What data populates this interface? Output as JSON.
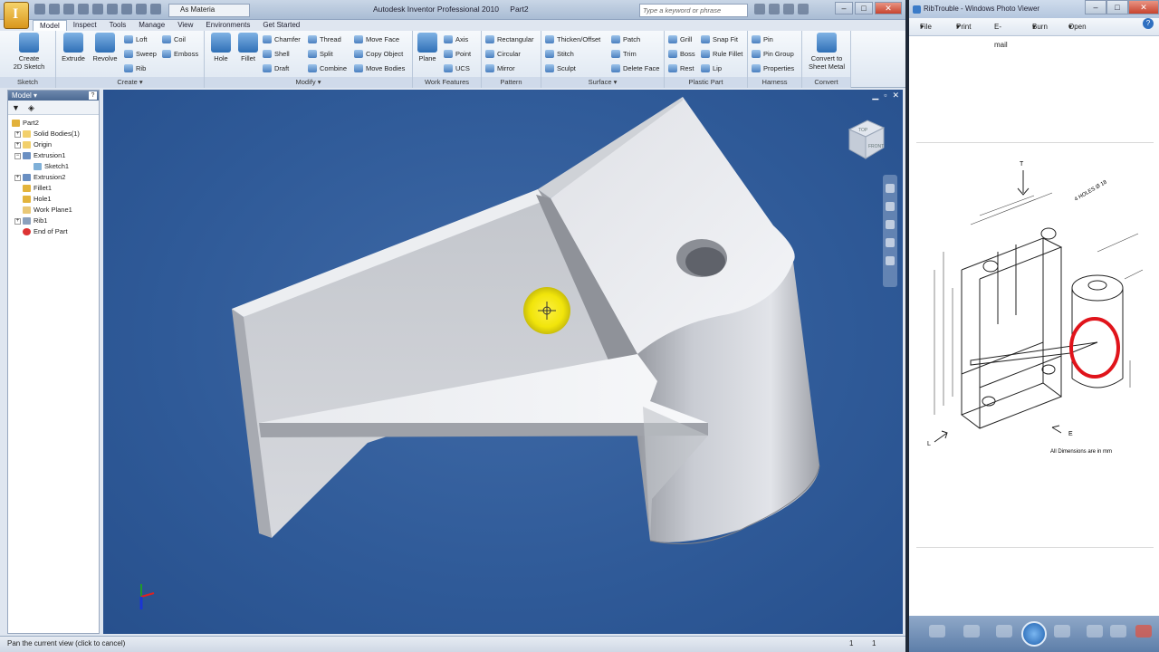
{
  "inventor": {
    "title_app": "Autodesk Inventor Professional 2010",
    "title_doc": "Part2",
    "material": "As Materia",
    "search_placeholder": "Type a keyword or phrase",
    "tabs": [
      "Model",
      "Inspect",
      "Tools",
      "Manage",
      "View",
      "Environments",
      "Get Started"
    ],
    "ribbon": {
      "sketch": {
        "create": "Create",
        "sketch2d": "2D Sketch",
        "label": "Sketch"
      },
      "create": {
        "extrude": "Extrude",
        "revolve": "Revolve",
        "loft": "Loft",
        "coil": "Coil",
        "sweep": "Sweep",
        "emboss": "Emboss",
        "rib": "Rib",
        "label": "Create"
      },
      "modify": {
        "hole": "Hole",
        "fillet": "Fillet",
        "chamfer": "Chamfer",
        "thread": "Thread",
        "shell": "Shell",
        "split": "Split",
        "draft": "Draft",
        "combine": "Combine",
        "move_face": "Move Face",
        "copy_object": "Copy Object",
        "move_bodies": "Move Bodies",
        "label": "Modify"
      },
      "work": {
        "plane": "Plane",
        "axis": "Axis",
        "point": "Point",
        "ucs": "UCS",
        "label": "Work Features"
      },
      "pattern": {
        "rectangular": "Rectangular",
        "circular": "Circular",
        "mirror": "Mirror",
        "label": "Pattern"
      },
      "surface": {
        "thicken": "Thicken/Offset",
        "stitch": "Stitch",
        "sculpt": "Sculpt",
        "patch": "Patch",
        "trim": "Trim",
        "delete_face": "Delete Face",
        "label": "Surface"
      },
      "plastic": {
        "grill": "Grill",
        "snap_fit": "Snap Fit",
        "boss": "Boss",
        "rule_fillet": "Rule Fillet",
        "rest": "Rest",
        "lip": "Lip",
        "label": "Plastic Part"
      },
      "harness": {
        "pin": "Pin",
        "pin_group": "Pin Group",
        "properties": "Properties",
        "label": "Harness"
      },
      "convert": {
        "to": "Convert to",
        "sheet_metal": "Sheet Metal",
        "label": "Convert"
      }
    },
    "browser": {
      "title": "Model",
      "help": "?",
      "items": [
        {
          "label": "Part2",
          "indent": 0,
          "icon": "part-icon"
        },
        {
          "label": "Solid Bodies(1)",
          "indent": 1,
          "icon": "folder-icon"
        },
        {
          "label": "Origin",
          "indent": 1,
          "icon": "folder-icon"
        },
        {
          "label": "Extrusion1",
          "indent": 1,
          "icon": "extrude-icon"
        },
        {
          "label": "Sketch1",
          "indent": 2,
          "icon": "sketch-icon"
        },
        {
          "label": "Extrusion2",
          "indent": 1,
          "icon": "extrude-icon"
        },
        {
          "label": "Fillet1",
          "indent": 1,
          "icon": "fillet-icon"
        },
        {
          "label": "Hole1",
          "indent": 1,
          "icon": "hole-icon"
        },
        {
          "label": "Work Plane1",
          "indent": 1,
          "icon": "workplane-icon"
        },
        {
          "label": "Rib1",
          "indent": 1,
          "icon": "rib-icon"
        },
        {
          "label": "End of Part",
          "indent": 1,
          "icon": "end-of-part-icon"
        }
      ]
    },
    "viewcube": {
      "top": "TOP",
      "front": "FRONT"
    },
    "status": {
      "message": "Pan the current view (click to cancel)",
      "count1": "1",
      "count2": "1"
    }
  },
  "photoviewer": {
    "title": "RibTrouble - Windows Photo Viewer",
    "menu": [
      "File",
      "Print",
      "E-mail",
      "Burn",
      "Open"
    ],
    "drawing": {
      "note": "All Dimensions are in mm",
      "holes": "4 HOLES Ø 18",
      "view_t": "T",
      "view_e": "E",
      "view_l": "L"
    }
  },
  "colors": {
    "viewport": "#2f5a98",
    "highlight": "#f3ea00",
    "markup": "#e0141b",
    "accent": "#3a7bc8"
  }
}
